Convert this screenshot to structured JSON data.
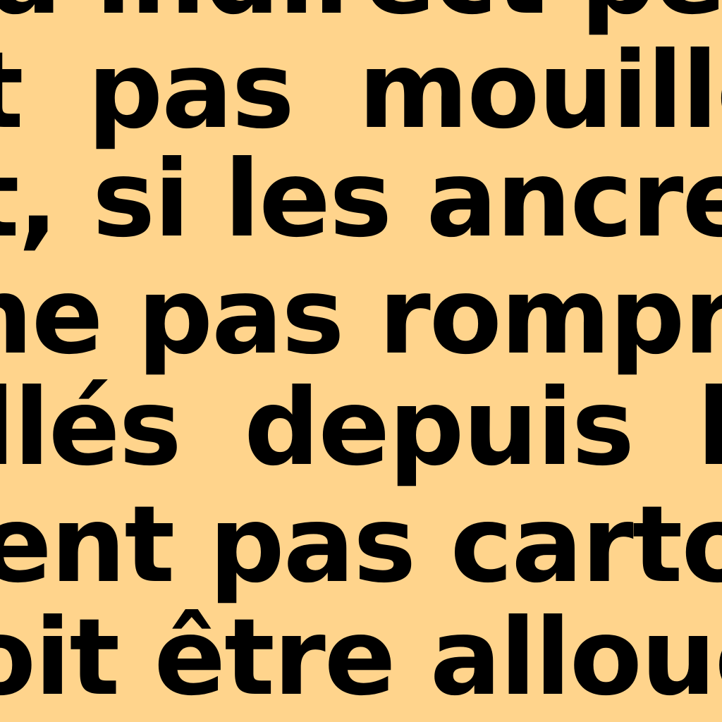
{
  "document": {
    "background_color": "#FFD48C",
    "text_color": "#000000",
    "lines": [
      "a indirect peut",
      "t pas mouiller",
      "t, si les ancres",
      "ne pas rompre",
      "llés depuis la",
      "ent pas carto-",
      "oit être allouée"
    ]
  }
}
